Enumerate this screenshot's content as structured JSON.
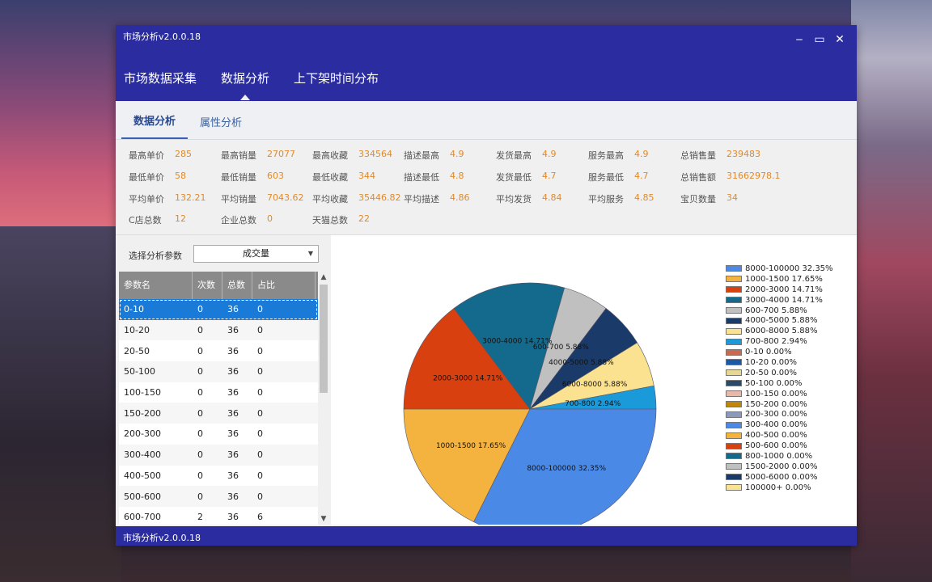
{
  "window": {
    "title": "市场分析v2.0.0.18",
    "status_text": "市场分析v2.0.0.18"
  },
  "main_nav": [
    "市场数据采集",
    "数据分析",
    "上下架时间分布"
  ],
  "sub_nav": [
    "数据分析",
    "属性分析"
  ],
  "stats": [
    [
      {
        "k": "最高单价",
        "v": "285"
      },
      {
        "k": "最高销量",
        "v": "27077"
      },
      {
        "k": "最高收藏",
        "v": "334564"
      },
      {
        "k": "描述最高",
        "v": "4.9"
      },
      {
        "k": "发货最高",
        "v": "4.9"
      },
      {
        "k": "服务最高",
        "v": "4.9"
      },
      {
        "k": "总销售量",
        "v": "239483"
      }
    ],
    [
      {
        "k": "最低单价",
        "v": "58"
      },
      {
        "k": "最低销量",
        "v": "603"
      },
      {
        "k": "最低收藏",
        "v": "344"
      },
      {
        "k": "描述最低",
        "v": "4.8"
      },
      {
        "k": "发货最低",
        "v": "4.7"
      },
      {
        "k": "服务最低",
        "v": "4.7"
      },
      {
        "k": "总销售额",
        "v": "31662978.1"
      }
    ],
    [
      {
        "k": "平均单价",
        "v": "132.21"
      },
      {
        "k": "平均销量",
        "v": "7043.62"
      },
      {
        "k": "平均收藏",
        "v": "35446.82"
      },
      {
        "k": "平均描述",
        "v": "4.86"
      },
      {
        "k": "平均发货",
        "v": "4.84"
      },
      {
        "k": "平均服务",
        "v": "4.85"
      },
      {
        "k": "宝贝数量",
        "v": "34"
      }
    ],
    [
      {
        "k": "C店总数",
        "v": "12"
      },
      {
        "k": "企业总数",
        "v": "0"
      },
      {
        "k": "天猫总数",
        "v": "22"
      }
    ]
  ],
  "param_select": {
    "label": "选择分析参数",
    "value": "成交量"
  },
  "grid": {
    "columns": [
      "参数名",
      "次数",
      "总数",
      "占比"
    ],
    "rows": [
      [
        "0-10",
        "0",
        "36",
        "0"
      ],
      [
        "10-20",
        "0",
        "36",
        "0"
      ],
      [
        "20-50",
        "0",
        "36",
        "0"
      ],
      [
        "50-100",
        "0",
        "36",
        "0"
      ],
      [
        "100-150",
        "0",
        "36",
        "0"
      ],
      [
        "150-200",
        "0",
        "36",
        "0"
      ],
      [
        "200-300",
        "0",
        "36",
        "0"
      ],
      [
        "300-400",
        "0",
        "36",
        "0"
      ],
      [
        "400-500",
        "0",
        "36",
        "0"
      ],
      [
        "500-600",
        "0",
        "36",
        "0"
      ],
      [
        "600-700",
        "2",
        "36",
        "6"
      ]
    ]
  },
  "chart_data": {
    "type": "pie",
    "slices": [
      {
        "name": "8000-100000",
        "value": 32.35,
        "label": "8000-100000 32.35%",
        "color": "#4a8ae6"
      },
      {
        "name": "1000-1500",
        "value": 17.65,
        "label": "1000-1500 17.65%",
        "color": "#f4b23e"
      },
      {
        "name": "2000-3000",
        "value": 14.71,
        "label": "2000-3000 14.71%",
        "color": "#d84010"
      },
      {
        "name": "3000-4000",
        "value": 14.71,
        "label": "3000-4000 14.71%",
        "color": "#146a8c"
      },
      {
        "name": "600-700",
        "value": 5.88,
        "label": "600-700 5.88%",
        "color": "#c0c0c0"
      },
      {
        "name": "4000-5000",
        "value": 5.88,
        "label": "4000-5000 5.88%",
        "color": "#1a3a6a"
      },
      {
        "name": "6000-8000",
        "value": 5.88,
        "label": "6000-8000 5.88%",
        "color": "#fbe290"
      },
      {
        "name": "700-800",
        "value": 2.94,
        "label": "700-800 2.94%",
        "color": "#1a9ad8"
      }
    ],
    "legend": [
      {
        "text": "8000-100000 32.35%",
        "color": "#4a8ae6"
      },
      {
        "text": "1000-1500 17.65%",
        "color": "#f4b23e"
      },
      {
        "text": "2000-3000 14.71%",
        "color": "#d84010"
      },
      {
        "text": "3000-4000 14.71%",
        "color": "#146a8c"
      },
      {
        "text": "600-700 5.88%",
        "color": "#c0c0c0"
      },
      {
        "text": "4000-5000 5.88%",
        "color": "#1a3a6a"
      },
      {
        "text": "6000-8000 5.88%",
        "color": "#fbe290"
      },
      {
        "text": "700-800 2.94%",
        "color": "#1a9ad8"
      },
      {
        "text": "0-10 0.00%",
        "color": "#c86a50"
      },
      {
        "text": "10-20 0.00%",
        "color": "#1a5aa8"
      },
      {
        "text": "20-50 0.00%",
        "color": "#e6d890"
      },
      {
        "text": "50-100 0.00%",
        "color": "#2a4a6a"
      },
      {
        "text": "100-150 0.00%",
        "color": "#e8b8a8"
      },
      {
        "text": "150-200 0.00%",
        "color": "#c0860a"
      },
      {
        "text": "200-300 0.00%",
        "color": "#8a9ab8"
      },
      {
        "text": "300-400 0.00%",
        "color": "#4a8ae6"
      },
      {
        "text": "400-500 0.00%",
        "color": "#f4b23e"
      },
      {
        "text": "500-600 0.00%",
        "color": "#d84010"
      },
      {
        "text": "800-1000 0.00%",
        "color": "#146a8c"
      },
      {
        "text": "1500-2000 0.00%",
        "color": "#c0c0c0"
      },
      {
        "text": "5000-6000 0.00%",
        "color": "#1a3a6a"
      },
      {
        "text": "100000+ 0.00%",
        "color": "#fbe290"
      }
    ],
    "legend_position": "right"
  }
}
